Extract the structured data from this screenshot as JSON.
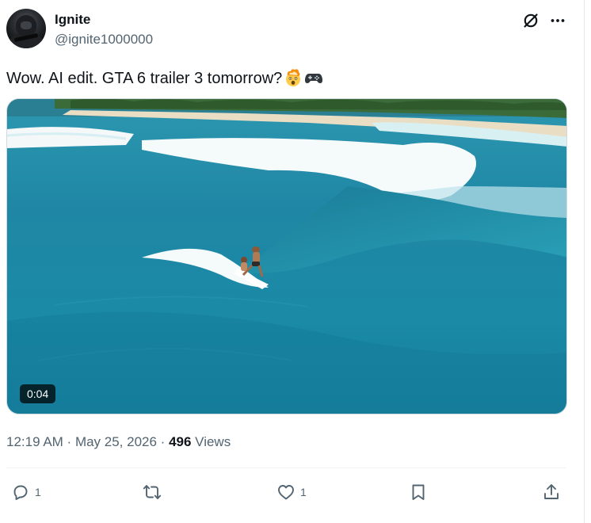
{
  "author": {
    "display_name": "Ignite",
    "handle": "@ignite1000000"
  },
  "tweet": {
    "text": "Wow. AI edit. GTA 6 trailer 3 tomorrow?",
    "emojis": [
      "exploding-head-emoji",
      "game-controller-emoji"
    ]
  },
  "media": {
    "type": "video",
    "duration": "0:04"
  },
  "meta": {
    "time": "12:19 AM",
    "separator": " · ",
    "date": "May 25, 2026",
    "views_count": "496",
    "views_label": "Views"
  },
  "actions": {
    "reply_count": "1",
    "like_count": "1"
  },
  "icons": {
    "header_right": [
      "grok-icon",
      "more-icon"
    ],
    "actions": [
      "reply-icon",
      "retweet-icon",
      "like-icon",
      "bookmark-icon",
      "share-icon"
    ]
  },
  "colors": {
    "text": "#0f1419",
    "secondary": "#536471",
    "divider": "#eff3f4"
  }
}
